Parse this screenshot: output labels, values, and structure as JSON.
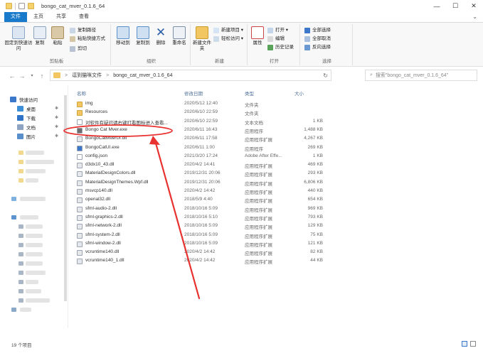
{
  "window": {
    "title": "bongo_cat_mver_0.1.6_64",
    "minimize": "—",
    "maximize": "☐",
    "close": "✕"
  },
  "tabs": [
    {
      "label": "文件"
    },
    {
      "label": "主页"
    },
    {
      "label": "共享"
    },
    {
      "label": "查看"
    }
  ],
  "ribbon": {
    "clipboard": {
      "group": "剪贴板",
      "pin": "固定到快速访问",
      "copy": "复制",
      "paste": "粘贴",
      "copy_path": "复制路径",
      "paste_shortcut": "粘贴快捷方式",
      "cut": "剪切"
    },
    "organize": {
      "group": "组织",
      "move_to": "移动到",
      "copy_to": "复制到",
      "delete": "删除",
      "rename": "重命名"
    },
    "new": {
      "group": "新建",
      "new_folder": "新建文件夹",
      "new_item": "新建项目 ▾",
      "easy_access": "轻松访问 ▾"
    },
    "open": {
      "group": "打开",
      "properties": "属性",
      "open": "打开 ▾",
      "edit": "编辑",
      "history": "历史记录"
    },
    "select": {
      "group": "选择",
      "select_all": "全部选择",
      "select_none": "全部取消",
      "invert": "反向选择"
    }
  },
  "address": {
    "back": "←",
    "forward": "→",
    "recent": "▾",
    "up": "↑",
    "crumbs": [
      "逗到猫咪文件",
      "bongo_cat_mver_0.1.6_64"
    ],
    "separator": ">",
    "refresh": "↻",
    "search_placeholder": "搜索\"bongo_cat_mver_0.1.6_64\""
  },
  "navpane": {
    "quick_access": "快速访问",
    "desktop": "桌面",
    "downloads": "下载",
    "documents": "文档",
    "pictures": "图片",
    "pin": "✱"
  },
  "columns": {
    "name": "名称",
    "date": "修改日期",
    "type": "类型",
    "size": "大小"
  },
  "files": [
    {
      "name": "img",
      "date": "2020/5/12 12:40",
      "type": "文件夹",
      "size": "",
      "icon": "folder"
    },
    {
      "name": "Resources",
      "date": "2020/6/10 22:59",
      "type": "文件夹",
      "size": "",
      "icon": "folder"
    },
    {
      "name": "对软件有疑问请右键打看图标进入查看...",
      "date": "2020/6/10 22:59",
      "type": "文本文档",
      "size": "1 KB",
      "icon": "text"
    },
    {
      "name": "Bongo Cat Mver.exe",
      "date": "2020/6/11 16:43",
      "type": "应用程序",
      "size": "1,488 KB",
      "icon": "exe"
    },
    {
      "name": "BongoCatMverUI.dll",
      "date": "2020/6/11 17:58",
      "type": "应用程序扩展",
      "size": "4,267 KB",
      "icon": "dll"
    },
    {
      "name": "BongoCatUI.exe",
      "date": "2020/6/11 1:00",
      "type": "应用程序",
      "size": "269 KB",
      "icon": "exe2"
    },
    {
      "name": "config.json",
      "date": "2021/3/20 17:24",
      "type": "Adobe After Effe...",
      "size": "1 KB",
      "icon": "json"
    },
    {
      "name": "d3dx10_43.dll",
      "date": "2020/4/2 14:41",
      "type": "应用程序扩展",
      "size": "469 KB",
      "icon": "dll"
    },
    {
      "name": "MaterialDesignColors.dll",
      "date": "2019/12/31 20:06",
      "type": "应用程序扩展",
      "size": "293 KB",
      "icon": "dll"
    },
    {
      "name": "MaterialDesignThemes.Wpf.dll",
      "date": "2019/12/31 20:06",
      "type": "应用程序扩展",
      "size": "6,806 KB",
      "icon": "dll"
    },
    {
      "name": "msvcp140.dll",
      "date": "2020/4/2 14:42",
      "type": "应用程序扩展",
      "size": "440 KB",
      "icon": "dll"
    },
    {
      "name": "openal32.dll",
      "date": "2018/5/9 4:40",
      "type": "应用程序扩展",
      "size": "654 KB",
      "icon": "dll"
    },
    {
      "name": "sfml-audio-2.dll",
      "date": "2018/10/16 5:09",
      "type": "应用程序扩展",
      "size": "969 KB",
      "icon": "dll"
    },
    {
      "name": "sfml-graphics-2.dll",
      "date": "2018/10/16 5:10",
      "type": "应用程序扩展",
      "size": "793 KB",
      "icon": "dll"
    },
    {
      "name": "sfml-network-2.dll",
      "date": "2018/10/16 5:09",
      "type": "应用程序扩展",
      "size": "129 KB",
      "icon": "dll"
    },
    {
      "name": "sfml-system-2.dll",
      "date": "2018/10/16 5:09",
      "type": "应用程序扩展",
      "size": "75 KB",
      "icon": "dll"
    },
    {
      "name": "sfml-window-2.dll",
      "date": "2018/10/16 5:09",
      "type": "应用程序扩展",
      "size": "121 KB",
      "icon": "dll"
    },
    {
      "name": "vcruntime140.dll",
      "date": "2020/4/2 14:42",
      "type": "应用程序扩展",
      "size": "82 KB",
      "icon": "dll"
    },
    {
      "name": "vcruntime140_1.dll",
      "date": "2020/4/2 14:42",
      "type": "应用程序扩展",
      "size": "44 KB",
      "icon": "dll"
    }
  ],
  "status": {
    "count": "19 个项目"
  },
  "colors": {
    "accent": "#1979ca",
    "folder": "#f2c661",
    "annotation": "#e8322f",
    "header_text": "#4d6f9a"
  }
}
